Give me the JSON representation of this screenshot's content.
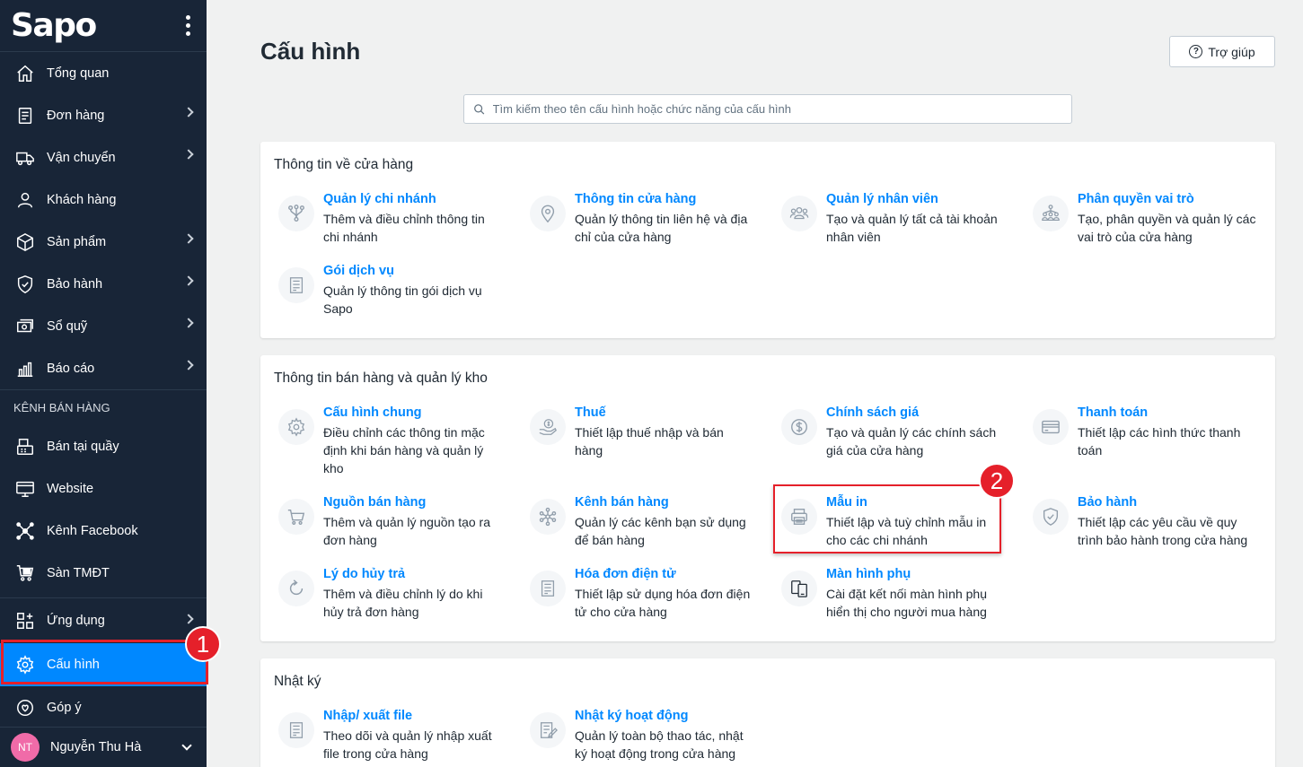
{
  "app": {
    "logo": "Sapo"
  },
  "sidebar": {
    "items": [
      {
        "label": "Tổng quan",
        "icon": "home-icon",
        "chevron": false
      },
      {
        "label": "Đơn hàng",
        "icon": "order-icon",
        "chevron": true
      },
      {
        "label": "Vận chuyển",
        "icon": "truck-icon",
        "chevron": true
      },
      {
        "label": "Khách hàng",
        "icon": "user-icon",
        "chevron": false
      },
      {
        "label": "Sản phẩm",
        "icon": "box-icon",
        "chevron": true
      },
      {
        "label": "Bảo hành",
        "icon": "shield-icon",
        "chevron": true
      },
      {
        "label": "Sổ quỹ",
        "icon": "cashbook-icon",
        "chevron": true
      },
      {
        "label": "Báo cáo",
        "icon": "report-icon",
        "chevron": true
      }
    ],
    "channels_label": "KÊNH BÁN HÀNG",
    "channels": [
      {
        "label": "Bán tại quầy",
        "icon": "pos-icon"
      },
      {
        "label": "Website",
        "icon": "website-icon"
      },
      {
        "label": "Kênh Facebook",
        "icon": "facebook-network-icon"
      },
      {
        "label": "Sàn TMĐT",
        "icon": "marketplace-icon"
      }
    ],
    "apps": {
      "label": "Ứng dụng",
      "icon": "apps-icon"
    },
    "settings": {
      "label": "Cấu hình",
      "icon": "gear-icon"
    },
    "feedback": {
      "label": "Góp ý",
      "icon": "feedback-icon"
    },
    "user": {
      "initials": "NT",
      "name": "Nguyễn Thu Hà"
    }
  },
  "badges": {
    "one": "1",
    "two": "2"
  },
  "main": {
    "title": "Cấu hình",
    "help_label": "Trợ giúp",
    "search_placeholder": "Tìm kiếm theo tên cấu hình hoặc chức năng của cấu hình",
    "sections": [
      {
        "title": "Thông tin về cửa hàng",
        "items": [
          {
            "title": "Quản lý chi nhánh",
            "desc": "Thêm và điều chỉnh thông tin chi nhánh",
            "icon": "branch-icon"
          },
          {
            "title": "Thông tin cửa hàng",
            "desc": "Quản lý thông tin liên hệ và địa chỉ của cửa hàng",
            "icon": "location-pin-icon"
          },
          {
            "title": "Quản lý nhân viên",
            "desc": "Tạo và quản lý tất cả tài khoản nhân viên",
            "icon": "staff-group-icon"
          },
          {
            "title": "Phân quyền vai trò",
            "desc": "Tạo, phân quyền và quản lý các vai trò của cửa hàng",
            "icon": "role-hierarchy-icon"
          },
          {
            "title": "Gói dịch vụ",
            "desc": "Quản lý thông tin gói dịch vụ Sapo",
            "icon": "receipt-icon"
          }
        ]
      },
      {
        "title": "Thông tin bán hàng và quản lý kho",
        "items": [
          {
            "title": "Cấu hình chung",
            "desc": "Điều chỉnh các thông tin mặc định khi bán hàng và quản lý kho",
            "icon": "gear-icon"
          },
          {
            "title": "Thuế",
            "desc": "Thiết lập thuế nhập và bán hàng",
            "icon": "tax-icon"
          },
          {
            "title": "Chính sách giá",
            "desc": "Tạo và quản lý các chính sách giá của cửa hàng",
            "icon": "dollar-icon"
          },
          {
            "title": "Thanh toán",
            "desc": "Thiết lập các hình thức thanh toán",
            "icon": "card-icon"
          },
          {
            "title": "Nguồn bán hàng",
            "desc": "Thêm và quản lý nguồn tạo ra đơn hàng",
            "icon": "cart-icon"
          },
          {
            "title": "Kênh bán hàng",
            "desc": "Quản lý các kênh bạn sử dụng để bán hàng",
            "icon": "network-icon"
          },
          {
            "title": "Mẫu in",
            "desc": "Thiết lập và tuỳ chỉnh mẫu in cho các chi nhánh",
            "icon": "printer-icon"
          },
          {
            "title": "Bảo hành",
            "desc": "Thiết lập các yêu cầu về quy trình bảo hành trong cửa hàng",
            "icon": "shield-check-icon"
          },
          {
            "title": "Lý do hủy trả",
            "desc": "Thêm và điều chỉnh lý do khi hủy trả đơn hàng",
            "icon": "refresh-icon"
          },
          {
            "title": "Hóa đơn điện tử",
            "desc": "Thiết lập sử dụng hóa đơn điện tử cho cửa hàng",
            "icon": "invoice-icon"
          },
          {
            "title": "Màn hình phụ",
            "desc": "Cài đặt kết nối màn hình phụ hiển thị cho người mua hàng",
            "icon": "dual-screen-icon"
          }
        ]
      },
      {
        "title": "Nhật ký",
        "items": [
          {
            "title": "Nhập/ xuất file",
            "desc": "Theo dõi và quản lý nhập xuất file trong cửa hàng",
            "icon": "file-icon"
          },
          {
            "title": "Nhật ký hoạt động",
            "desc": "Quản lý toàn bộ thao tác, nhật ký hoạt động trong cửa hàng",
            "icon": "activity-log-icon"
          }
        ]
      }
    ]
  }
}
